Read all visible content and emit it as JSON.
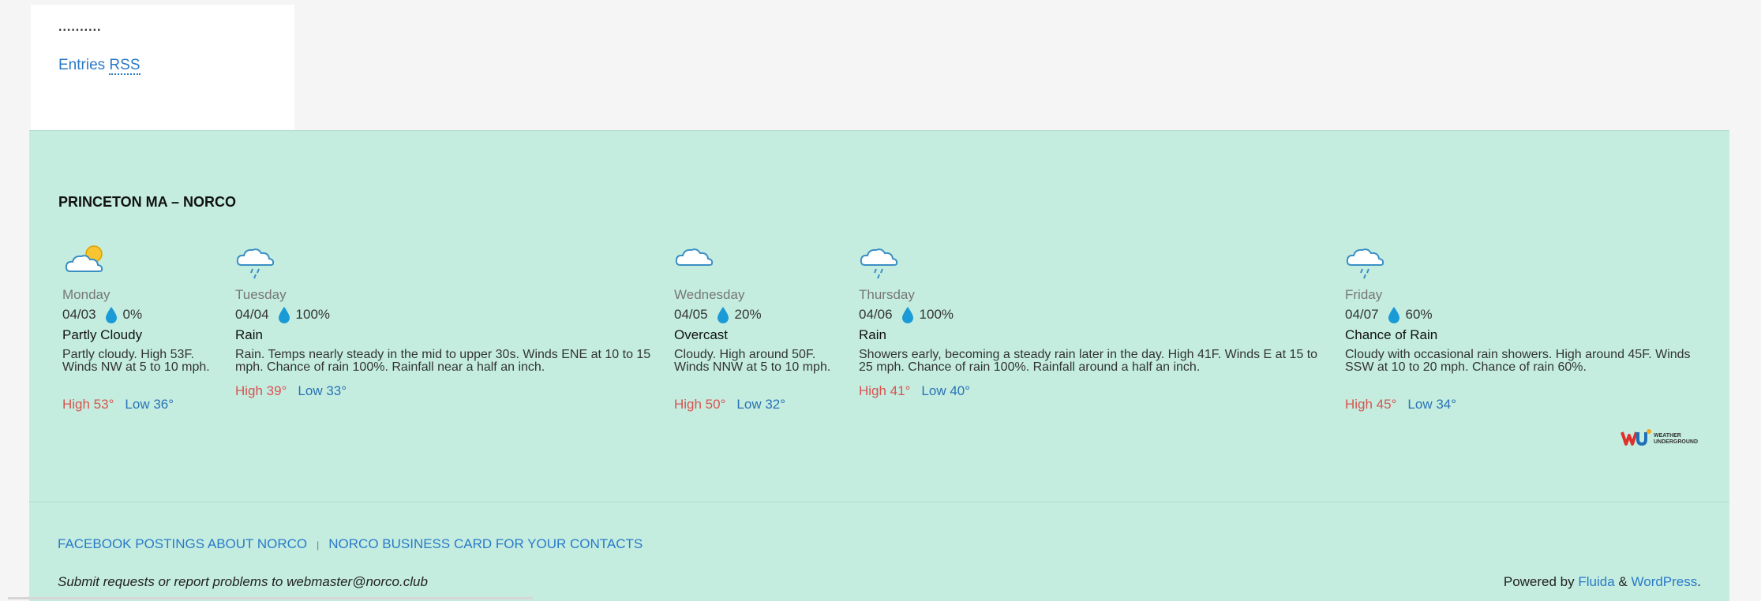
{
  "sidebar": {
    "dots": "..........",
    "rss_prefix": "Entries",
    "rss_abbr": "RSS"
  },
  "weather": {
    "title": "PRINCETON MA – NORCO",
    "days": [
      {
        "name": "Monday",
        "date": "04/03",
        "precip": "0%",
        "condition": "Partly Cloudy",
        "description": "Partly cloudy. High 53F. Winds NW at 5 to 10 mph.",
        "high": "High 53°",
        "low": "Low 36°",
        "icon": "partly-cloudy-icon"
      },
      {
        "name": "Tuesday",
        "date": "04/04",
        "precip": "100%",
        "condition": "Rain",
        "description": "Rain. Temps nearly steady in the mid to upper 30s. Winds ENE at 10 to 15 mph. Chance of rain 100%. Rainfall near a half an inch.",
        "high": "High 39°",
        "low": "Low 33°",
        "icon": "rain-icon"
      },
      {
        "name": "Wednesday",
        "date": "04/05",
        "precip": "20%",
        "condition": "Overcast",
        "description": "Cloudy. High around 50F. Winds NNW at 5 to 10 mph.",
        "high": "High 50°",
        "low": "Low 32°",
        "icon": "cloud-icon"
      },
      {
        "name": "Thursday",
        "date": "04/06",
        "precip": "100%",
        "condition": "Rain",
        "description": "Showers early, becoming a steady rain later in the day. High 41F. Winds E at 15 to 25 mph. Chance of rain 100%. Rainfall around a half an inch.",
        "high": "High 41°",
        "low": "Low 40°",
        "icon": "rain-icon"
      },
      {
        "name": "Friday",
        "date": "04/07",
        "precip": "60%",
        "condition": "Chance of Rain",
        "description": "Cloudy with occasional rain showers. High around 45F. Winds SSW at 10 to 20 mph. Chance of rain 60%.",
        "high": "High 45°",
        "low": "Low 34°",
        "icon": "rain-icon"
      }
    ],
    "logo_text": "WEATHER UNDERGROUND"
  },
  "footer": {
    "link1": "FACEBOOK POSTINGS ABOUT NORCO",
    "separator": "|",
    "link2": "NORCO BUSINESS CARD FOR YOUR CONTACTS",
    "note": "Submit requests or report problems to webmaster@norco.club",
    "powered_prefix": "Powered by",
    "powered_theme": "Fluida",
    "powered_amp": "&",
    "powered_wp": "WordPress",
    "powered_period": "."
  },
  "colors": {
    "widget_bg": "#c4ede0",
    "link": "#2a7ac8",
    "high": "#d9534f",
    "low": "#2a72b5",
    "drop": "#1a9ad6"
  }
}
